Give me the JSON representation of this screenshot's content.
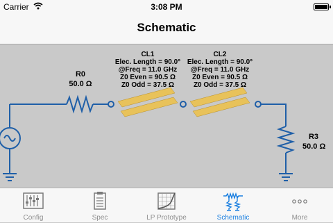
{
  "status_bar": {
    "carrier": "Carrier",
    "time": "3:08 PM"
  },
  "nav": {
    "title": "Schematic"
  },
  "schematic": {
    "r0": {
      "name": "R0",
      "value": "50.0 Ω"
    },
    "r3": {
      "name": "R3",
      "value": "50.0 Ω"
    },
    "cl1": {
      "name": "CL1",
      "elec_length": "Elec. Length = 90.0°",
      "freq": "@Freq = 11.0 GHz",
      "z0_even": "Z0 Even = 90.5 Ω",
      "z0_odd": "Z0 Odd = 37.5 Ω"
    },
    "cl2": {
      "name": "CL2",
      "elec_length": "Elec. Length = 90.0°",
      "freq": "@Freq = 11.0 GHz",
      "z0_even": "Z0 Even = 90.5 Ω",
      "z0_odd": "Z0 Odd = 37.5 Ω"
    },
    "colors": {
      "wire": "#1f5fa8",
      "coupler_gold": "#e8c25a"
    }
  },
  "tabs": [
    {
      "label": "Config",
      "icon": "config-icon",
      "active": false
    },
    {
      "label": "Spec",
      "icon": "spec-icon",
      "active": false
    },
    {
      "label": "LP Prototype",
      "icon": "lp-prototype-icon",
      "active": false
    },
    {
      "label": "Schematic",
      "icon": "schematic-icon",
      "active": true
    },
    {
      "label": "More",
      "icon": "more-icon",
      "active": false
    }
  ],
  "accent_color": "#1a7fe0"
}
